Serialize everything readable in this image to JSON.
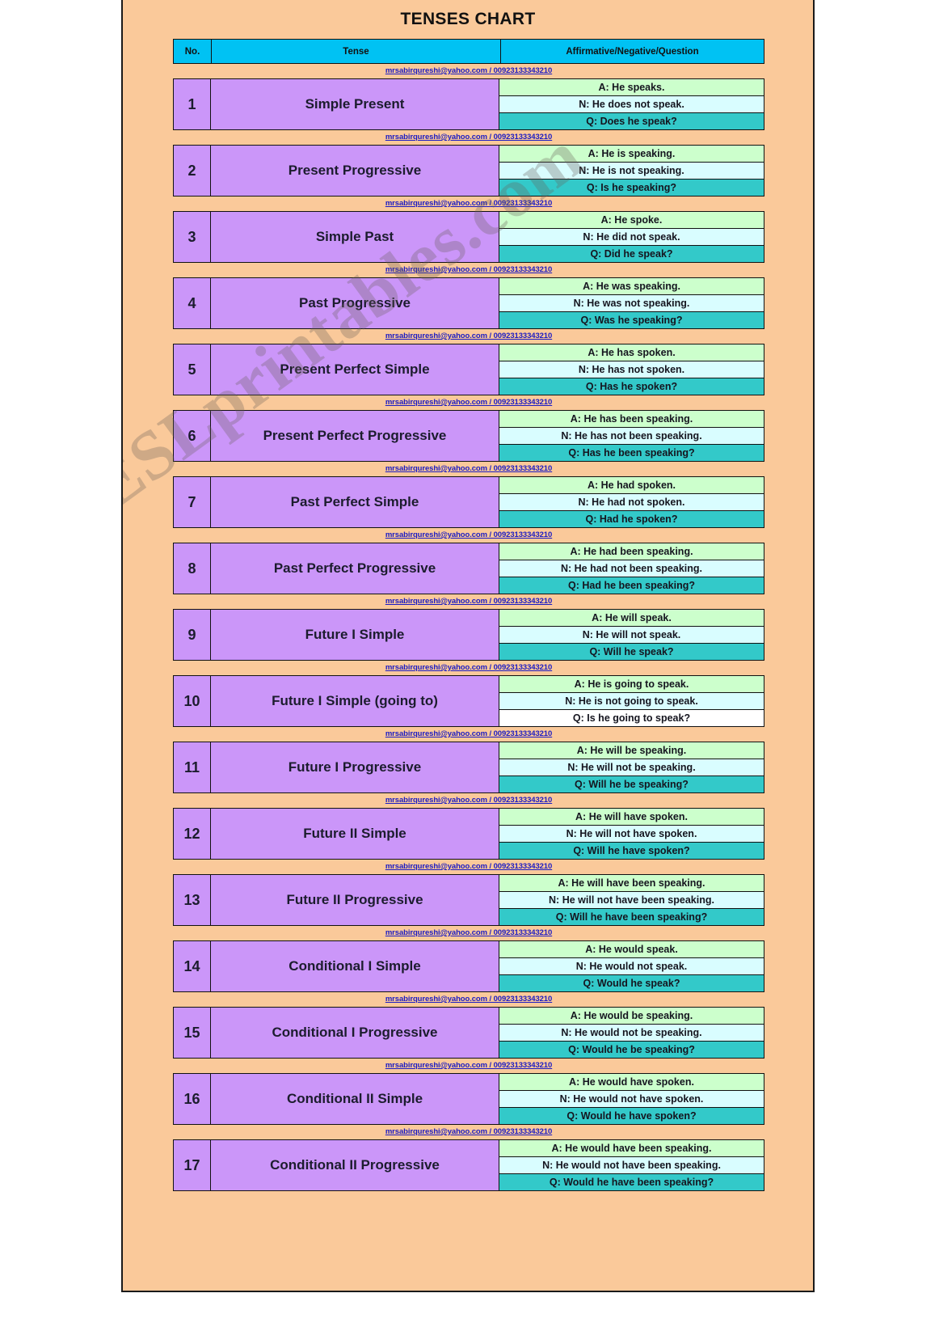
{
  "page": {
    "title": "TENSES CHART",
    "watermark": "ESLprintables.com",
    "contact": "mrsabirqureshi@yahoo.com  /  00923133343210",
    "colors": {
      "background": "#fac99a",
      "header": "#00c2f3",
      "tense_cell": "#cb96f9",
      "affirmative": "#ccffcc",
      "negative": "#d9fdff",
      "question": "#33c9c9",
      "contact_text": "#1b1bc4"
    }
  },
  "table": {
    "headers": {
      "no": "No.",
      "tense": "Tense",
      "forms": "Affirmative/Negative/Question"
    },
    "rows": [
      {
        "no": "1",
        "tense": "Simple Present",
        "affirmative": "A: He speaks.",
        "negative": "N: He does not speak.",
        "question": "Q: Does he speak?",
        "question_style": "teal"
      },
      {
        "no": "2",
        "tense": "Present Progressive",
        "affirmative": "A: He is speaking.",
        "negative": "N: He is not speaking.",
        "question": "Q: Is he speaking?",
        "question_style": "teal"
      },
      {
        "no": "3",
        "tense": "Simple Past",
        "affirmative": "A: He spoke.",
        "negative": "N: He did not speak.",
        "question": "Q: Did he speak?",
        "question_style": "teal"
      },
      {
        "no": "4",
        "tense": "Past Progressive",
        "affirmative": "A: He was speaking.",
        "negative": "N: He was not speaking.",
        "question": "Q: Was he speaking?",
        "question_style": "teal"
      },
      {
        "no": "5",
        "tense": "Present Perfect Simple",
        "affirmative": "A: He has spoken.",
        "negative": "N: He has not spoken.",
        "question": "Q: Has he spoken?",
        "question_style": "teal"
      },
      {
        "no": "6",
        "tense": "Present Perfect Progressive",
        "affirmative": "A: He has been speaking.",
        "negative": "N: He has not been speaking.",
        "question": "Q: Has he been speaking?",
        "question_style": "teal"
      },
      {
        "no": "7",
        "tense": "Past Perfect Simple",
        "affirmative": "A: He had spoken.",
        "negative": "N: He had not spoken.",
        "question": "Q: Had he spoken?",
        "question_style": "teal"
      },
      {
        "no": "8",
        "tense": "Past Perfect Progressive",
        "affirmative": "A: He had been speaking.",
        "negative": "N: He had not been speaking.",
        "question": "Q: Had he been speaking?",
        "question_style": "teal"
      },
      {
        "no": "9",
        "tense": "Future I Simple",
        "affirmative": "A: He will speak.",
        "negative": "N: He will not speak.",
        "question": "Q: Will he speak?",
        "question_style": "teal"
      },
      {
        "no": "10",
        "tense": "Future I Simple (going to)",
        "affirmative": "A: He is going to speak.",
        "negative": "N: He is not going to speak.",
        "question": "Q: Is he going to speak?",
        "question_style": "white"
      },
      {
        "no": "11",
        "tense": "Future I Progressive",
        "affirmative": "A: He will be speaking.",
        "negative": "N: He will not be speaking.",
        "question": "Q: Will he be speaking?",
        "question_style": "teal"
      },
      {
        "no": "12",
        "tense": "Future II Simple",
        "affirmative": "A: He will have spoken.",
        "negative": "N: He will not have spoken.",
        "question": "Q: Will he have spoken?",
        "question_style": "teal"
      },
      {
        "no": "13",
        "tense": "Future II Progressive",
        "affirmative": "A: He will have been speaking.",
        "negative": "N: He will not have been speaking.",
        "question": "Q: Will he have been speaking?",
        "question_style": "teal"
      },
      {
        "no": "14",
        "tense": "Conditional I Simple",
        "affirmative": "A: He would speak.",
        "negative": "N: He would not speak.",
        "question": "Q: Would he speak?",
        "question_style": "teal"
      },
      {
        "no": "15",
        "tense": "Conditional I Progressive",
        "affirmative": "A: He would be speaking.",
        "negative": "N: He would not be speaking.",
        "question": "Q: Would he be speaking?",
        "question_style": "teal"
      },
      {
        "no": "16",
        "tense": "Conditional II Simple",
        "affirmative": "A: He would have spoken.",
        "negative": "N: He would not have spoken.",
        "question": "Q: Would he have spoken?",
        "question_style": "teal"
      },
      {
        "no": "17",
        "tense": "Conditional II Progressive",
        "affirmative": "A: He would have been speaking.",
        "negative": "N: He would not have been speaking.",
        "question": "Q: Would he have been speaking?",
        "question_style": "teal"
      }
    ]
  }
}
